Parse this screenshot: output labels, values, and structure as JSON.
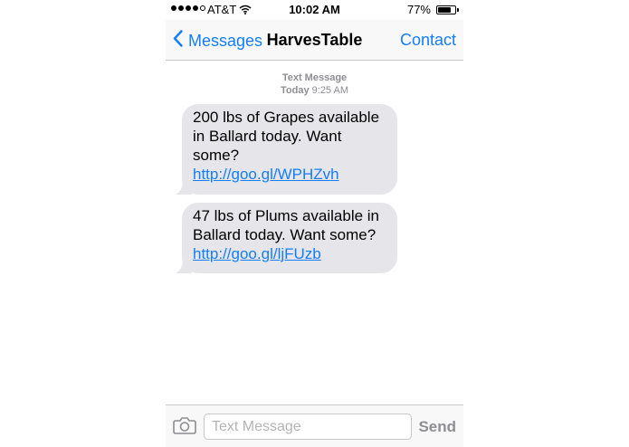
{
  "status_bar": {
    "carrier": "AT&T",
    "time": "10:02 AM",
    "battery": "77%",
    "battery_level": 0.77,
    "signal_bars_filled": 4,
    "signal_bars_total": 5,
    "icons": [
      "signal-dots-icon",
      "wifi-icon",
      "battery-icon"
    ]
  },
  "nav": {
    "back_label": "Messages",
    "title": "HarvesTable",
    "contact_label": "Contact"
  },
  "conversation": {
    "service": "Text Message",
    "day": "Today",
    "time": "9:25 AM",
    "messages": [
      {
        "text": "200 lbs of Grapes available in Ballard today.  Want some? ",
        "link": "http://goo.gl/WPHZvh"
      },
      {
        "text": "47 lbs of Plums available in Ballard today.  Want some? ",
        "link": "http://goo.gl/ljFUzb"
      }
    ]
  },
  "composer": {
    "placeholder": "Text Message",
    "value": "",
    "send_label": "Send"
  },
  "colors": {
    "accent": "#147efb",
    "bubble": "#e5e5ea",
    "meta_text": "#8e8e93"
  }
}
